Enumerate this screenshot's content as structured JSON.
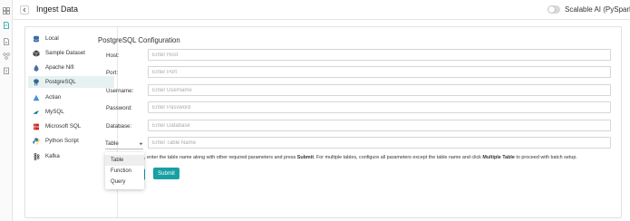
{
  "rail": {
    "icons": [
      "grid-icon",
      "document-icon",
      "file-add-icon",
      "cluster-icon",
      "clipboard-icon"
    ]
  },
  "header": {
    "title": "Ingest Data",
    "toggle_label": "Scalable AI (PySpark)",
    "toggle_on": false
  },
  "sidebar": {
    "items": [
      {
        "label": "Local",
        "icon": "database-icon",
        "color": "#3a6ea5"
      },
      {
        "label": "Sample Dataset",
        "icon": "box-icon",
        "color": "#444444"
      },
      {
        "label": "Apache Nifi",
        "icon": "drop-icon",
        "color": "#4a6fa5"
      },
      {
        "label": "PostgreSQL",
        "icon": "elephant-icon",
        "color": "#336791"
      },
      {
        "label": "Actian",
        "icon": "triangle-icon",
        "color": "#4a90d9"
      },
      {
        "label": "MySQL",
        "icon": "dolphin-icon",
        "color": "#00758f"
      },
      {
        "label": "Microsoft SQL",
        "icon": "server-icon",
        "color": "#cc2927"
      },
      {
        "label": "Python Script",
        "icon": "python-icon",
        "color": "#3776ab"
      },
      {
        "label": "Kafka",
        "icon": "kafka-icon",
        "color": "#333333"
      }
    ],
    "active_index": 3
  },
  "form": {
    "heading": "PostgreSQL Configuration",
    "fields": [
      {
        "label": "Host:",
        "placeholder": "Enter Host",
        "value": ""
      },
      {
        "label": "Port:",
        "placeholder": "Enter Port",
        "value": ""
      },
      {
        "label": "Username:",
        "placeholder": "Enter Username",
        "value": ""
      },
      {
        "label": "Password:",
        "placeholder": "Enter Password",
        "value": ""
      },
      {
        "label": "Database:",
        "placeholder": "Enter Database",
        "value": ""
      }
    ],
    "type_select": {
      "value": "Table",
      "placeholder": "Enter Table Name",
      "options": [
        "Table",
        "Function",
        "Query"
      ],
      "highlighted": "Table"
    },
    "help": {
      "part1": ", enter the table name along with other required parameters and press ",
      "bold1": "Submit",
      "part2": ". For multiple tables, configure all parameters except the table name and click ",
      "bold2": "Multiple Table",
      "part3": " to proceed with batch setup."
    },
    "submit_label": "Submit"
  },
  "colors": {
    "accent": "#19a0a3",
    "active_bg": "#e6f1f2"
  }
}
